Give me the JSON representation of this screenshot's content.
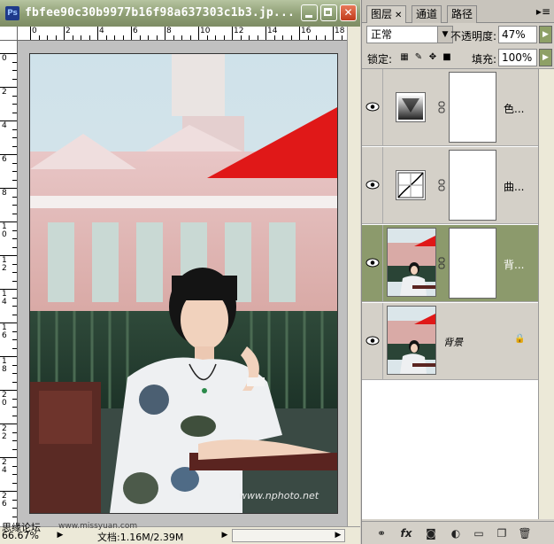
{
  "document": {
    "app_badge": "Ps",
    "title": "fbfee90c30b9977b16f98a637303c1b3.jp...",
    "zoom": "66.67%",
    "doc_size": "文档:1.16M/2.39M",
    "watermark_text": "思缘论坛",
    "watermark_url": "www.missyuan.com",
    "photo_watermark": "www.nphoto.net"
  },
  "rulers": {
    "top_labels": [
      "0",
      "2",
      "4",
      "6",
      "8",
      "10",
      "12",
      "14",
      "16",
      "18"
    ],
    "left_labels": [
      "0",
      "2",
      "4",
      "6",
      "8",
      "10",
      "12",
      "14",
      "16",
      "18",
      "20",
      "22",
      "24",
      "26"
    ]
  },
  "layers_panel": {
    "tabs": [
      "图层",
      "通道",
      "路径"
    ],
    "blend_mode": "正常",
    "opacity_label": "不透明度:",
    "opacity_value": "47%",
    "lock_label": "锁定:",
    "fill_label": "填充:",
    "fill_value": "100%",
    "layers": [
      {
        "name": "色...",
        "type": "color-balance-adjustment",
        "selected": false
      },
      {
        "name": "曲...",
        "type": "curves-adjustment",
        "selected": false
      },
      {
        "name": "背...",
        "type": "photo-with-mask",
        "selected": true
      },
      {
        "name": "背景",
        "type": "background",
        "selected": false,
        "locked": true
      }
    ]
  },
  "colors": {
    "title_bar": "#8e9e74",
    "selected_layer": "#8c9a6c",
    "close_button": "#c03a1a"
  }
}
